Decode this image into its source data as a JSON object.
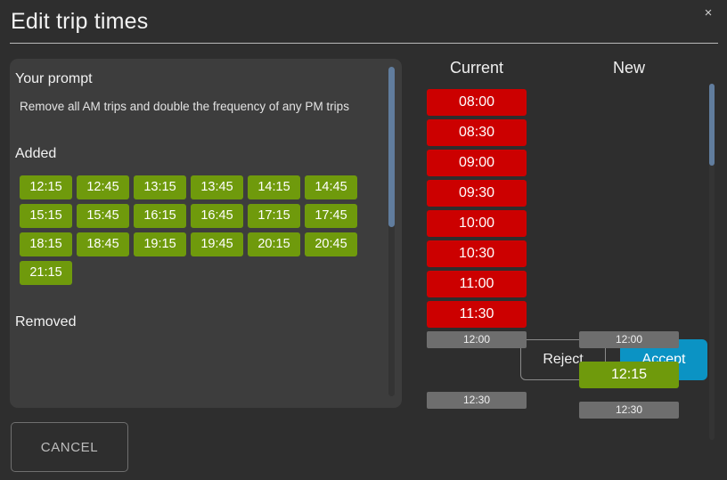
{
  "header": {
    "title": "Edit trip times",
    "close_label": "×"
  },
  "prompt_card": {
    "prompt_section_title": "Your prompt",
    "prompt_text": "Remove all AM trips and double the frequency of any PM trips",
    "added_section_title": "Added",
    "removed_section_title": "Removed",
    "added_times": [
      "12:15",
      "12:45",
      "13:15",
      "13:45",
      "14:15",
      "14:45",
      "15:15",
      "15:45",
      "16:15",
      "16:45",
      "17:15",
      "17:45",
      "18:15",
      "18:45",
      "19:15",
      "19:45",
      "20:15",
      "20:45",
      "21:15"
    ],
    "removed_times": [],
    "reject_label": "Reject",
    "accept_label": "Accept"
  },
  "footer": {
    "cancel_label": "CANCEL"
  },
  "compare_panel": {
    "current_header": "Current",
    "new_header": "New",
    "current_times": [
      {
        "time": "08:00",
        "state": "removed"
      },
      {
        "time": "08:30",
        "state": "removed"
      },
      {
        "time": "09:00",
        "state": "removed"
      },
      {
        "time": "09:30",
        "state": "removed"
      },
      {
        "time": "10:00",
        "state": "removed"
      },
      {
        "time": "10:30",
        "state": "removed"
      },
      {
        "time": "11:00",
        "state": "removed"
      },
      {
        "time": "11:30",
        "state": "removed"
      },
      {
        "time": "12:00",
        "state": "unchanged"
      },
      {
        "time": "",
        "state": "spacer"
      },
      {
        "time": "12:30",
        "state": "unchanged"
      }
    ],
    "new_times": [
      {
        "time": "",
        "state": "spacer"
      },
      {
        "time": "",
        "state": "spacer"
      },
      {
        "time": "",
        "state": "spacer"
      },
      {
        "time": "",
        "state": "spacer"
      },
      {
        "time": "",
        "state": "spacer"
      },
      {
        "time": "",
        "state": "spacer"
      },
      {
        "time": "",
        "state": "spacer"
      },
      {
        "time": "",
        "state": "spacer"
      },
      {
        "time": "12:00",
        "state": "unchanged"
      },
      {
        "time": "12:15",
        "state": "added"
      },
      {
        "time": "12:30",
        "state": "unchanged"
      }
    ]
  },
  "colors": {
    "page_background": "#2e2e2e",
    "card_background": "#3d3d3d",
    "added_green": "#6f9a0c",
    "removed_red": "#cc0000",
    "unchanged_gray": "#6e6e6e",
    "accept_blue": "#0b93c4",
    "scrollbar_thumb": "#617d9e"
  }
}
